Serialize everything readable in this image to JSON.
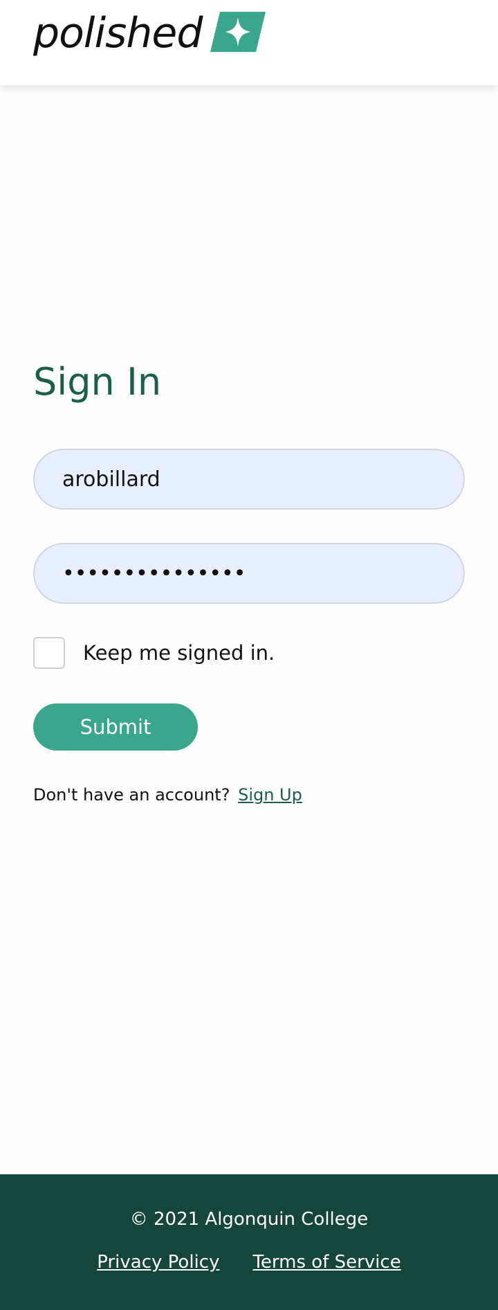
{
  "header": {
    "logo_text": "polished"
  },
  "signin": {
    "title": "Sign In",
    "username_value": "arobillard",
    "password_value": "•••••••••••••••",
    "remember_label": "Keep me signed in.",
    "remember_checked": false,
    "submit_label": "Submit",
    "no_account_text": "Don't have an account?",
    "signup_link": "Sign Up"
  },
  "footer": {
    "copyright": "© 2021 Algonquin College",
    "links": [
      {
        "label": "Privacy Policy"
      },
      {
        "label": "Terms of Service"
      }
    ]
  },
  "colors": {
    "brand_green": "#3aa68b",
    "heading_green": "#1b5e4a",
    "footer_bg": "#16463b",
    "input_bg": "#e8f0fe"
  },
  "icons": {
    "logo_mark": "sparkle-icon"
  }
}
